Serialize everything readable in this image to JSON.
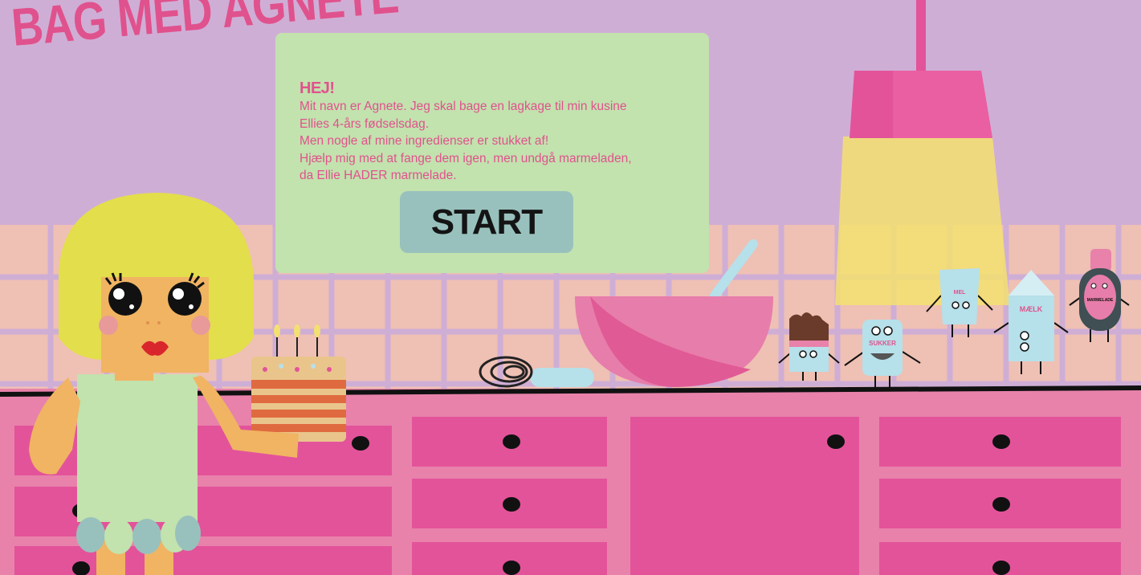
{
  "game": {
    "title": "BAG MED AGNETE"
  },
  "intro": {
    "heading": "HEJ!",
    "lines": [
      "Mit navn er Agnete. Jeg skal bage en lagkage til min kusine",
      "Ellies 4-års fødselsdag.",
      "Men nogle af mine ingredienser er stukket af!",
      "Hjælp mig med at fange dem igen, men undgå marmeladen,",
      "da Ellie HADER marmelade."
    ],
    "start_label": "START"
  },
  "ingredients": {
    "sukker": "SUKKER",
    "mel": "MEL",
    "maelk": "MÆLK",
    "marmelade": "MARMELADE"
  },
  "colors": {
    "wall": "#cfaed6",
    "tiles": "#efc0b4",
    "grout": "#cfaed6",
    "cabinet": "#e3539a",
    "cabinet_frame": "#e882ab",
    "panel": "#c2e2ae",
    "start_button": "#98c1bd",
    "accent_pink": "#e0528d",
    "lamp_shade": "#e3539a",
    "lamp_light": "#f3e070",
    "ingredient_blue": "#b6e0ea"
  }
}
